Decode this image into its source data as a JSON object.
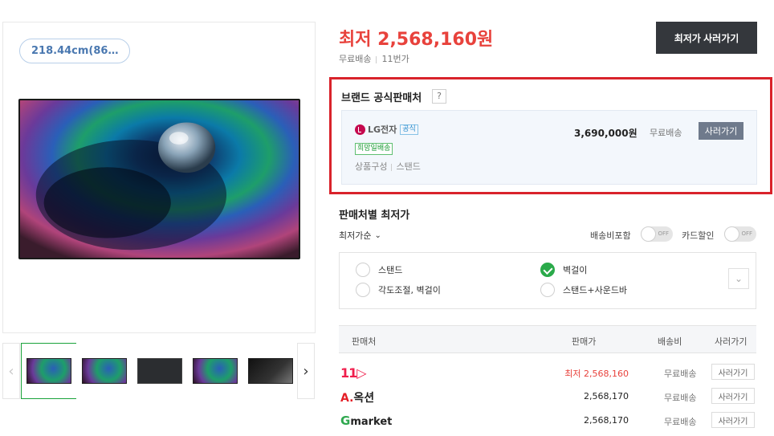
{
  "product": {
    "size_chip": "218.44cm(86…",
    "thumbnails": [
      {
        "name": "thumb-peacock-1",
        "active": true
      },
      {
        "name": "thumb-peacock-2",
        "active": false
      },
      {
        "name": "thumb-back",
        "active": false
      },
      {
        "name": "thumb-peacock-3",
        "active": false
      },
      {
        "name": "thumb-side",
        "active": false
      }
    ],
    "prev_arrow": "‹",
    "next_arrow": "›"
  },
  "pricing": {
    "lowest_price": "최저 2,568,160원",
    "free_shipping": "무료배송",
    "seller_label": "11번가",
    "buy_lowest_button": "최저가 사러가기"
  },
  "brand_official": {
    "title": "브랜드 공식판매처",
    "help_label": "?",
    "store_name": "LG전자",
    "official_badge": "공식",
    "hope_delivery_tag": "희망일배송",
    "composition_label": "상품구성",
    "composition_value": "스탠드",
    "price": "3,690,000원",
    "shipping": "무료배송",
    "go_button": "사러가기"
  },
  "sellers": {
    "title": "판매처별 최저가",
    "sort_label": "최저가순",
    "toggle_shipping_label": "배송비포함",
    "toggle_card_label": "카드할인",
    "toggle_off_text": "OFF",
    "options": [
      {
        "label": "스탠드",
        "checked": false
      },
      {
        "label": "벽걸이",
        "checked": true
      },
      {
        "label": "각도조절, 벽걸이",
        "checked": false
      },
      {
        "label": "스탠드+사운드바",
        "checked": false
      }
    ],
    "columns": {
      "seller": "판매처",
      "price": "판매가",
      "shipping": "배송비",
      "buy": "사러가기"
    },
    "rows": [
      {
        "seller": "11번가",
        "logo_text": "11",
        "price": "최저 2,568,160",
        "shipping": "무료배송",
        "button": "사러가기",
        "best": true
      },
      {
        "seller": "옥션",
        "logo_text": "옥션",
        "price": "2,568,170",
        "shipping": "무료배송",
        "button": "사러가기",
        "best": false
      },
      {
        "seller": "Gmarket",
        "logo_text": "market",
        "price": "2,568,170",
        "shipping": "무료배송",
        "button": "사러가기",
        "best": false
      }
    ]
  },
  "colors": {
    "price_red": "#e8423c",
    "highlight_border": "#d9232b",
    "check_green": "#2aaa4a",
    "dark_button": "#34373c"
  }
}
